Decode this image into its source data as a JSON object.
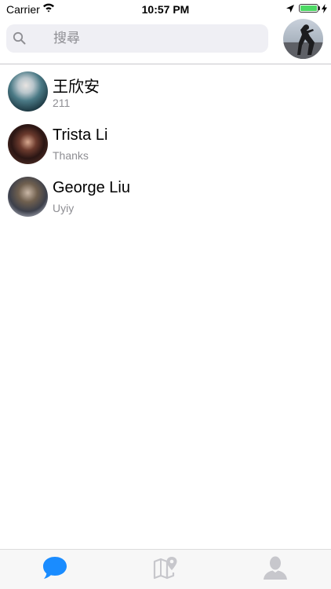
{
  "status_bar": {
    "carrier": "Carrier",
    "time": "10:57 PM",
    "battery_level": 1.0,
    "icons": [
      "wifi-icon",
      "location-arrow-icon",
      "battery-icon",
      "charging-bolt-icon"
    ]
  },
  "search": {
    "placeholder": "搜尋",
    "value": ""
  },
  "conversations": [
    {
      "name": "王欣安",
      "preview": "211"
    },
    {
      "name": "Trista Li",
      "preview": "Thanks"
    },
    {
      "name": "George Liu",
      "preview": "Uyiy"
    }
  ],
  "tab_bar": {
    "tabs": [
      {
        "icon": "chat-bubble-icon",
        "active": true
      },
      {
        "icon": "map-pin-icon",
        "active": false
      },
      {
        "icon": "person-icon",
        "active": false
      }
    ]
  },
  "colors": {
    "accent": "#1a8cff",
    "inactive_icon": "#c7c7cc",
    "secondary_text": "#8e8e93",
    "battery": "#4cd964"
  }
}
